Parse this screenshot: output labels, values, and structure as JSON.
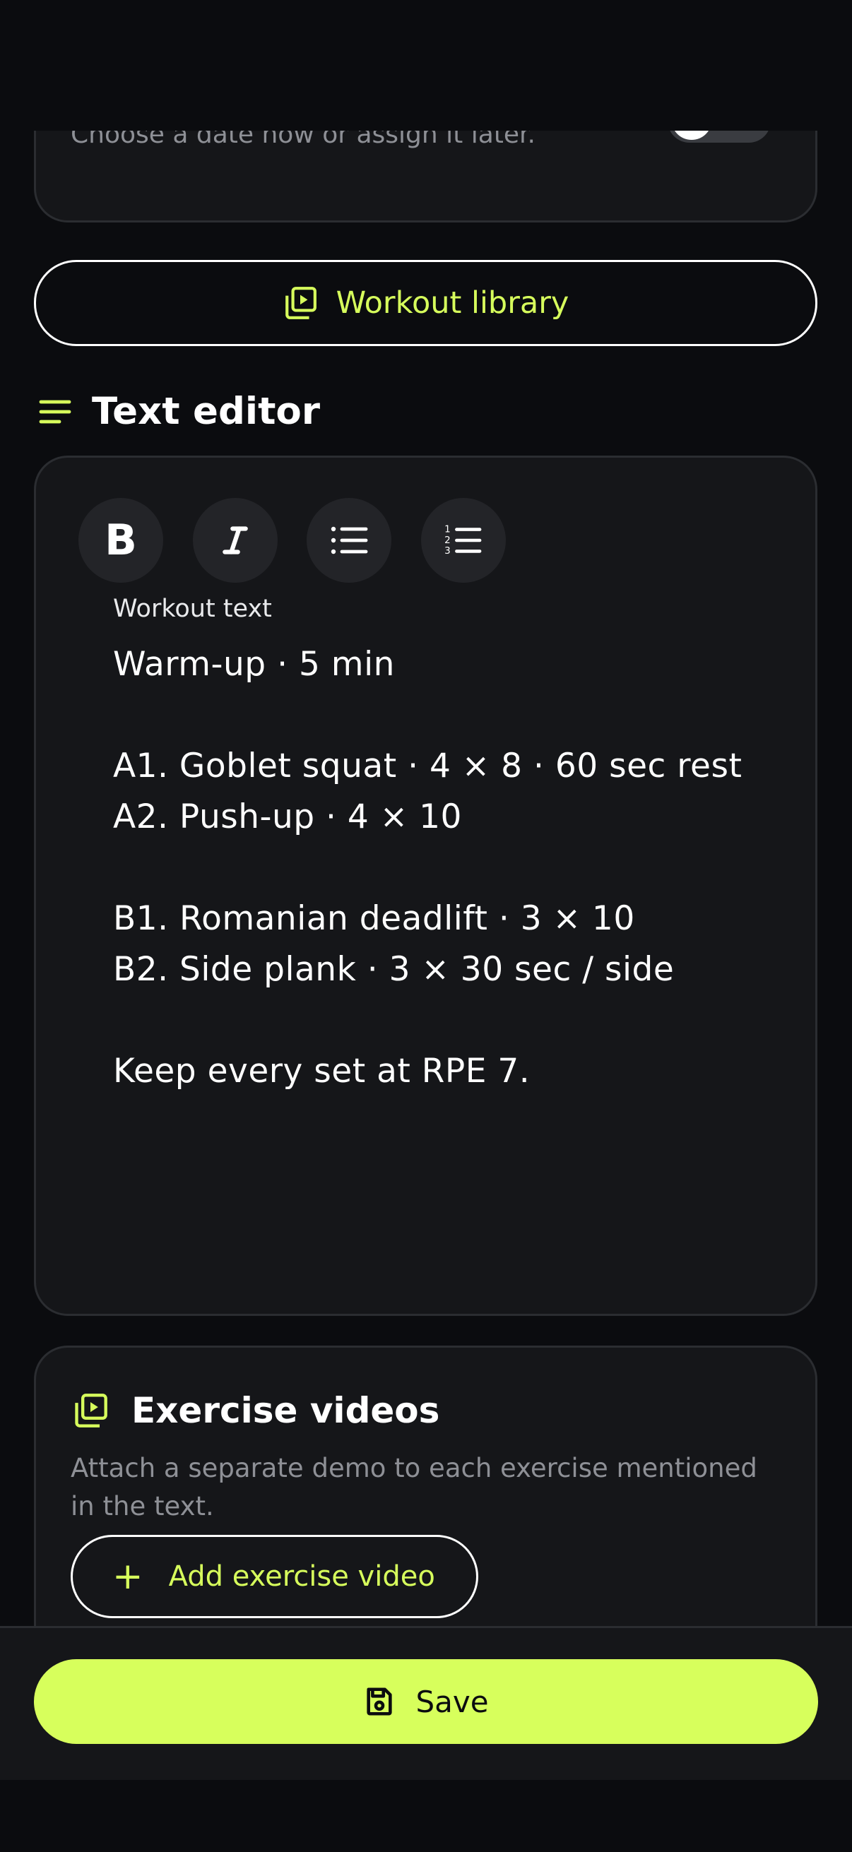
{
  "colors": {
    "background": "#0b0c0f",
    "card": "#151619",
    "card_border": "#2b2d31",
    "accent": "#d7ff5c",
    "muted_text": "#8e9096"
  },
  "schedule": {
    "hint": "Choose a date now or assign it later.",
    "toggle_on": false
  },
  "library_button": {
    "label": "Workout library",
    "icon": "video-library-icon"
  },
  "text_editor": {
    "title": "Text editor",
    "icon": "menu-lines-icon",
    "toolbar": {
      "bold_label": "B",
      "italic_icon": "italic-icon",
      "bullet_icon": "bulleted-list-icon",
      "numbered_icon": "numbered-list-icon"
    },
    "field_label": "Workout text",
    "lines": [
      "Warm-up · 5 min",
      "",
      "A1. Goblet squat · 4 × 8 · 60 sec rest",
      "A2. Push-up · 4 × 10",
      "",
      "B1. Romanian deadlift · 3 × 10",
      "B2. Side plank · 3 × 30 sec / side",
      "",
      "Keep every set at RPE 7."
    ]
  },
  "exercise_videos": {
    "title": "Exercise videos",
    "icon": "video-library-icon",
    "description": "Attach a separate demo to each exercise mentioned in the text.",
    "add_button_label": "Add exercise video",
    "add_icon": "plus-icon"
  },
  "save_button": {
    "label": "Save",
    "icon": "save-icon"
  }
}
